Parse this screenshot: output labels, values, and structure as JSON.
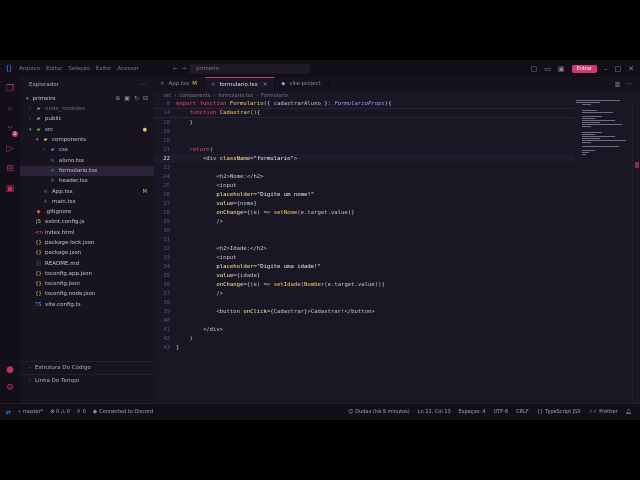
{
  "titlebar": {
    "menu": [
      "Arquivo",
      "Editar",
      "Seleção",
      "Exibir",
      "Acessar"
    ],
    "command_center": "primeiro",
    "entrar_label": "Entrar"
  },
  "sidebar": {
    "title": "Explorador",
    "root": "primeiro",
    "tree": [
      {
        "name": "node_modules",
        "kind": "folder",
        "depth": 1,
        "open": false,
        "muted": true
      },
      {
        "name": "public",
        "kind": "folder",
        "depth": 1,
        "open": false
      },
      {
        "name": "src",
        "kind": "folder",
        "depth": 1,
        "open": true,
        "status": "●"
      },
      {
        "name": "components",
        "kind": "folder",
        "depth": 2,
        "open": true
      },
      {
        "name": "css",
        "kind": "folder",
        "depth": 3,
        "open": false
      },
      {
        "name": "aluno.tsx",
        "kind": "tsx",
        "depth": 3
      },
      {
        "name": "formulario.tsx",
        "kind": "tsx",
        "depth": 3,
        "selected": true
      },
      {
        "name": "header.tsx",
        "kind": "tsx",
        "depth": 3
      },
      {
        "name": "App.tsx",
        "kind": "tsx",
        "depth": 2,
        "status": "M"
      },
      {
        "name": "main.tsx",
        "kind": "tsx",
        "depth": 2
      },
      {
        "name": ".gitignore",
        "kind": "git",
        "depth": 1
      },
      {
        "name": "eslint.config.js",
        "kind": "js",
        "depth": 1
      },
      {
        "name": "index.html",
        "kind": "html",
        "depth": 1
      },
      {
        "name": "package-lock.json",
        "kind": "json",
        "depth": 1
      },
      {
        "name": "package.json",
        "kind": "json",
        "depth": 1
      },
      {
        "name": "README.md",
        "kind": "md",
        "depth": 1
      },
      {
        "name": "tsconfig.app.json",
        "kind": "json",
        "depth": 1
      },
      {
        "name": "tsconfig.json",
        "kind": "json",
        "depth": 1
      },
      {
        "name": "tsconfig.node.json",
        "kind": "json",
        "depth": 1
      },
      {
        "name": "vite.config.ts",
        "kind": "ts",
        "depth": 1
      }
    ],
    "sections": [
      "Estrutura Do Código",
      "Linha Do Tempo"
    ]
  },
  "tabs": [
    {
      "label": "App.tsx",
      "modified": "M",
      "active": false
    },
    {
      "label": "formulario.tsx",
      "active": true
    },
    {
      "label": "vite-project",
      "active": false
    }
  ],
  "breadcrumbs": [
    "src",
    "components",
    "formulario.tsx",
    "Formulario"
  ],
  "code": {
    "current_line": 22,
    "lines": [
      {
        "n": "8",
        "html": "<span class=\"kw\">export function</span> <span class=\"fn\">Formulario</span>({ cadastrarAluno }: <span class=\"ty\">FormularioProps</span>){",
        "sticky": true
      },
      {
        "n": "14",
        "html": "    <span class=\"kw\">function</span> <span class=\"fn\">Cadastrar</span>(){",
        "sticky": true
      },
      {
        "n": "18",
        "html": "    }"
      },
      {
        "n": "19",
        "html": ""
      },
      {
        "n": "20",
        "html": ""
      },
      {
        "n": "21",
        "html": "    <span class=\"kw\">return</span>("
      },
      {
        "n": "22",
        "html": "        &lt;div <span class=\"at\">className</span>=<span class=\"st2\">\"formulario\"</span>&gt;"
      },
      {
        "n": "23",
        "html": ""
      },
      {
        "n": "24",
        "html": "            &lt;h2&gt;Nome:&lt;/h2&gt;"
      },
      {
        "n": "25",
        "html": "            &lt;input"
      },
      {
        "n": "26",
        "html": "            <span class=\"at\">placeholder</span>=<span class=\"st2\">\"Digite um nome!\"</span>"
      },
      {
        "n": "27",
        "html": "            <span class=\"at\">value</span>={nome}"
      },
      {
        "n": "28",
        "html": "            <span class=\"at\">onChange</span>={(e) =&gt; <span class=\"fn\">setNome</span>(e.target.value)}"
      },
      {
        "n": "29",
        "html": "            /&gt;"
      },
      {
        "n": "30",
        "html": ""
      },
      {
        "n": "31",
        "html": ""
      },
      {
        "n": "32",
        "html": "            &lt;h2&gt;Idade:&lt;/h2&gt;"
      },
      {
        "n": "33",
        "html": "            &lt;input"
      },
      {
        "n": "34",
        "html": "            <span class=\"at\">placeholder</span>=<span class=\"st2\">\"Digite uma idade!\"</span>"
      },
      {
        "n": "35",
        "html": "            <span class=\"at\">value</span>={idade}"
      },
      {
        "n": "36",
        "html": "            <span class=\"at\">onChange</span>={(e) =&gt; <span class=\"fn\">setIdade</span>(<span class=\"fn\">Number</span>(e.target.value))}"
      },
      {
        "n": "37",
        "html": "            /&gt;"
      },
      {
        "n": "38",
        "html": ""
      },
      {
        "n": "39",
        "html": "            &lt;button <span class=\"at\">onClick</span>={Cadastrar}&gt;Cadastrar!&lt;/button&gt;"
      },
      {
        "n": "40",
        "html": ""
      },
      {
        "n": "41",
        "html": "        &lt;/div&gt;"
      },
      {
        "n": "42",
        "html": "    )"
      },
      {
        "n": "43",
        "html": "}"
      }
    ]
  },
  "status": {
    "branch": "master*",
    "problems": "⊗ 0 ⚠ 0",
    "ports": "0",
    "discord": "Connected to Discord",
    "author": "Dudax (há 9 minutos)",
    "position": "Ln 22, Col 13",
    "spaces": "Espaços: 4",
    "encoding": "UTF-8",
    "eol": "CRLF",
    "language": "TypeScript JSX",
    "formatter": "Prettier"
  },
  "colors": {
    "accent": "#d03b6f",
    "bg": "#1a1724",
    "sidebar": "#17141f",
    "activity": "#120f18"
  }
}
